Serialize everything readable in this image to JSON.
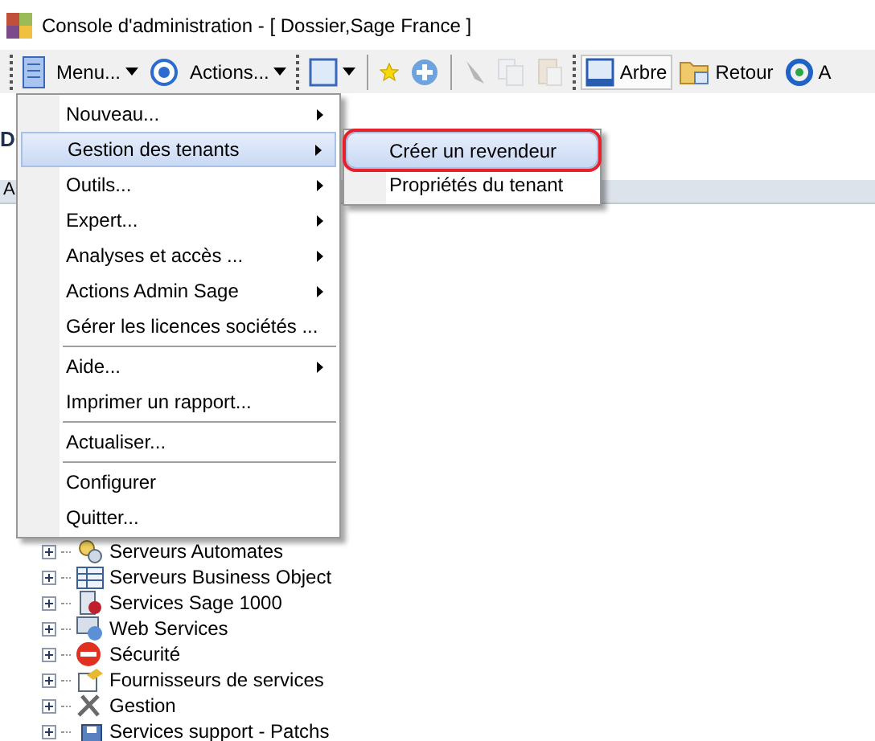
{
  "window": {
    "title": "Console d'administration  - [ Dossier,Sage France ]"
  },
  "toolbar": [
    {
      "kind": "grip"
    },
    {
      "kind": "button",
      "disabled": false,
      "selected": false,
      "dropdown": false
    },
    {
      "kind": "button",
      "label": "Menu...",
      "disabled": false,
      "selected": false,
      "dropdown": true
    },
    {
      "kind": "button",
      "disabled": false,
      "selected": false,
      "dropdown": false
    },
    {
      "kind": "button",
      "label": "Actions...",
      "disabled": false,
      "selected": false,
      "dropdown": true
    },
    {
      "kind": "grip"
    },
    {
      "kind": "button",
      "disabled": false,
      "selected": false,
      "dropdown": true
    },
    {
      "kind": "separator"
    },
    {
      "kind": "button",
      "disabled": false,
      "selected": false,
      "dropdown": false
    },
    {
      "kind": "button",
      "disabled": false,
      "selected": false,
      "dropdown": false
    },
    {
      "kind": "separator"
    },
    {
      "kind": "button",
      "disabled": true,
      "selected": false,
      "dropdown": false
    },
    {
      "kind": "button",
      "disabled": true,
      "selected": false,
      "dropdown": false
    },
    {
      "kind": "button",
      "disabled": true,
      "selected": false,
      "dropdown": false
    },
    {
      "kind": "grip"
    },
    {
      "kind": "button",
      "label": "Arbre",
      "disabled": false,
      "selected": true,
      "dropdown": false
    },
    {
      "kind": "button",
      "label": "Retour",
      "disabled": false,
      "selected": false,
      "dropdown": false
    },
    {
      "kind": "button",
      "label": "A",
      "disabled": false,
      "selected": false,
      "dropdown": false
    }
  ],
  "content": {
    "heading": "D",
    "column_header": "A"
  },
  "menu": [
    {
      "kind": "item",
      "label": "Nouveau...",
      "submenu": true,
      "selected": false
    },
    {
      "kind": "item",
      "label": "Gestion des tenants",
      "submenu": true,
      "selected": true
    },
    {
      "kind": "item",
      "label": "Outils...",
      "submenu": true,
      "selected": false
    },
    {
      "kind": "item",
      "label": "Expert...",
      "submenu": true,
      "selected": false
    },
    {
      "kind": "item",
      "label": "Analyses et accès ...",
      "submenu": true,
      "selected": false
    },
    {
      "kind": "item",
      "label": "Actions Admin Sage",
      "submenu": true,
      "selected": false
    },
    {
      "kind": "item",
      "label": "Gérer les licences sociétés  ...",
      "submenu": false,
      "selected": false
    },
    {
      "kind": "separator"
    },
    {
      "kind": "item",
      "label": "Aide...",
      "submenu": true,
      "selected": false
    },
    {
      "kind": "item",
      "label": "Imprimer un rapport...",
      "submenu": false,
      "selected": false
    },
    {
      "kind": "separator"
    },
    {
      "kind": "item",
      "label": "Actualiser...",
      "submenu": false,
      "selected": false
    },
    {
      "kind": "separator"
    },
    {
      "kind": "item",
      "label": "Configurer",
      "submenu": false,
      "selected": false
    },
    {
      "kind": "item",
      "label": "Quitter...",
      "submenu": false,
      "selected": false
    }
  ],
  "submenu": [
    {
      "label": "Créer un revendeur",
      "selected": true,
      "circled": true
    },
    {
      "label": "Propriétés du tenant",
      "selected": false,
      "circled": false
    }
  ],
  "tree": [
    {
      "label": "Serveurs Automates",
      "expanded": false
    },
    {
      "label": "Serveurs Business Object",
      "expanded": false
    },
    {
      "label": "Services Sage 1000",
      "expanded": false
    },
    {
      "label": "Web Services",
      "expanded": false
    },
    {
      "label": "Sécurité",
      "expanded": false
    },
    {
      "label": "Fournisseurs de services",
      "expanded": false
    },
    {
      "label": "Gestion",
      "expanded": false
    },
    {
      "label": "Services support - Patchs",
      "expanded": false
    }
  ]
}
